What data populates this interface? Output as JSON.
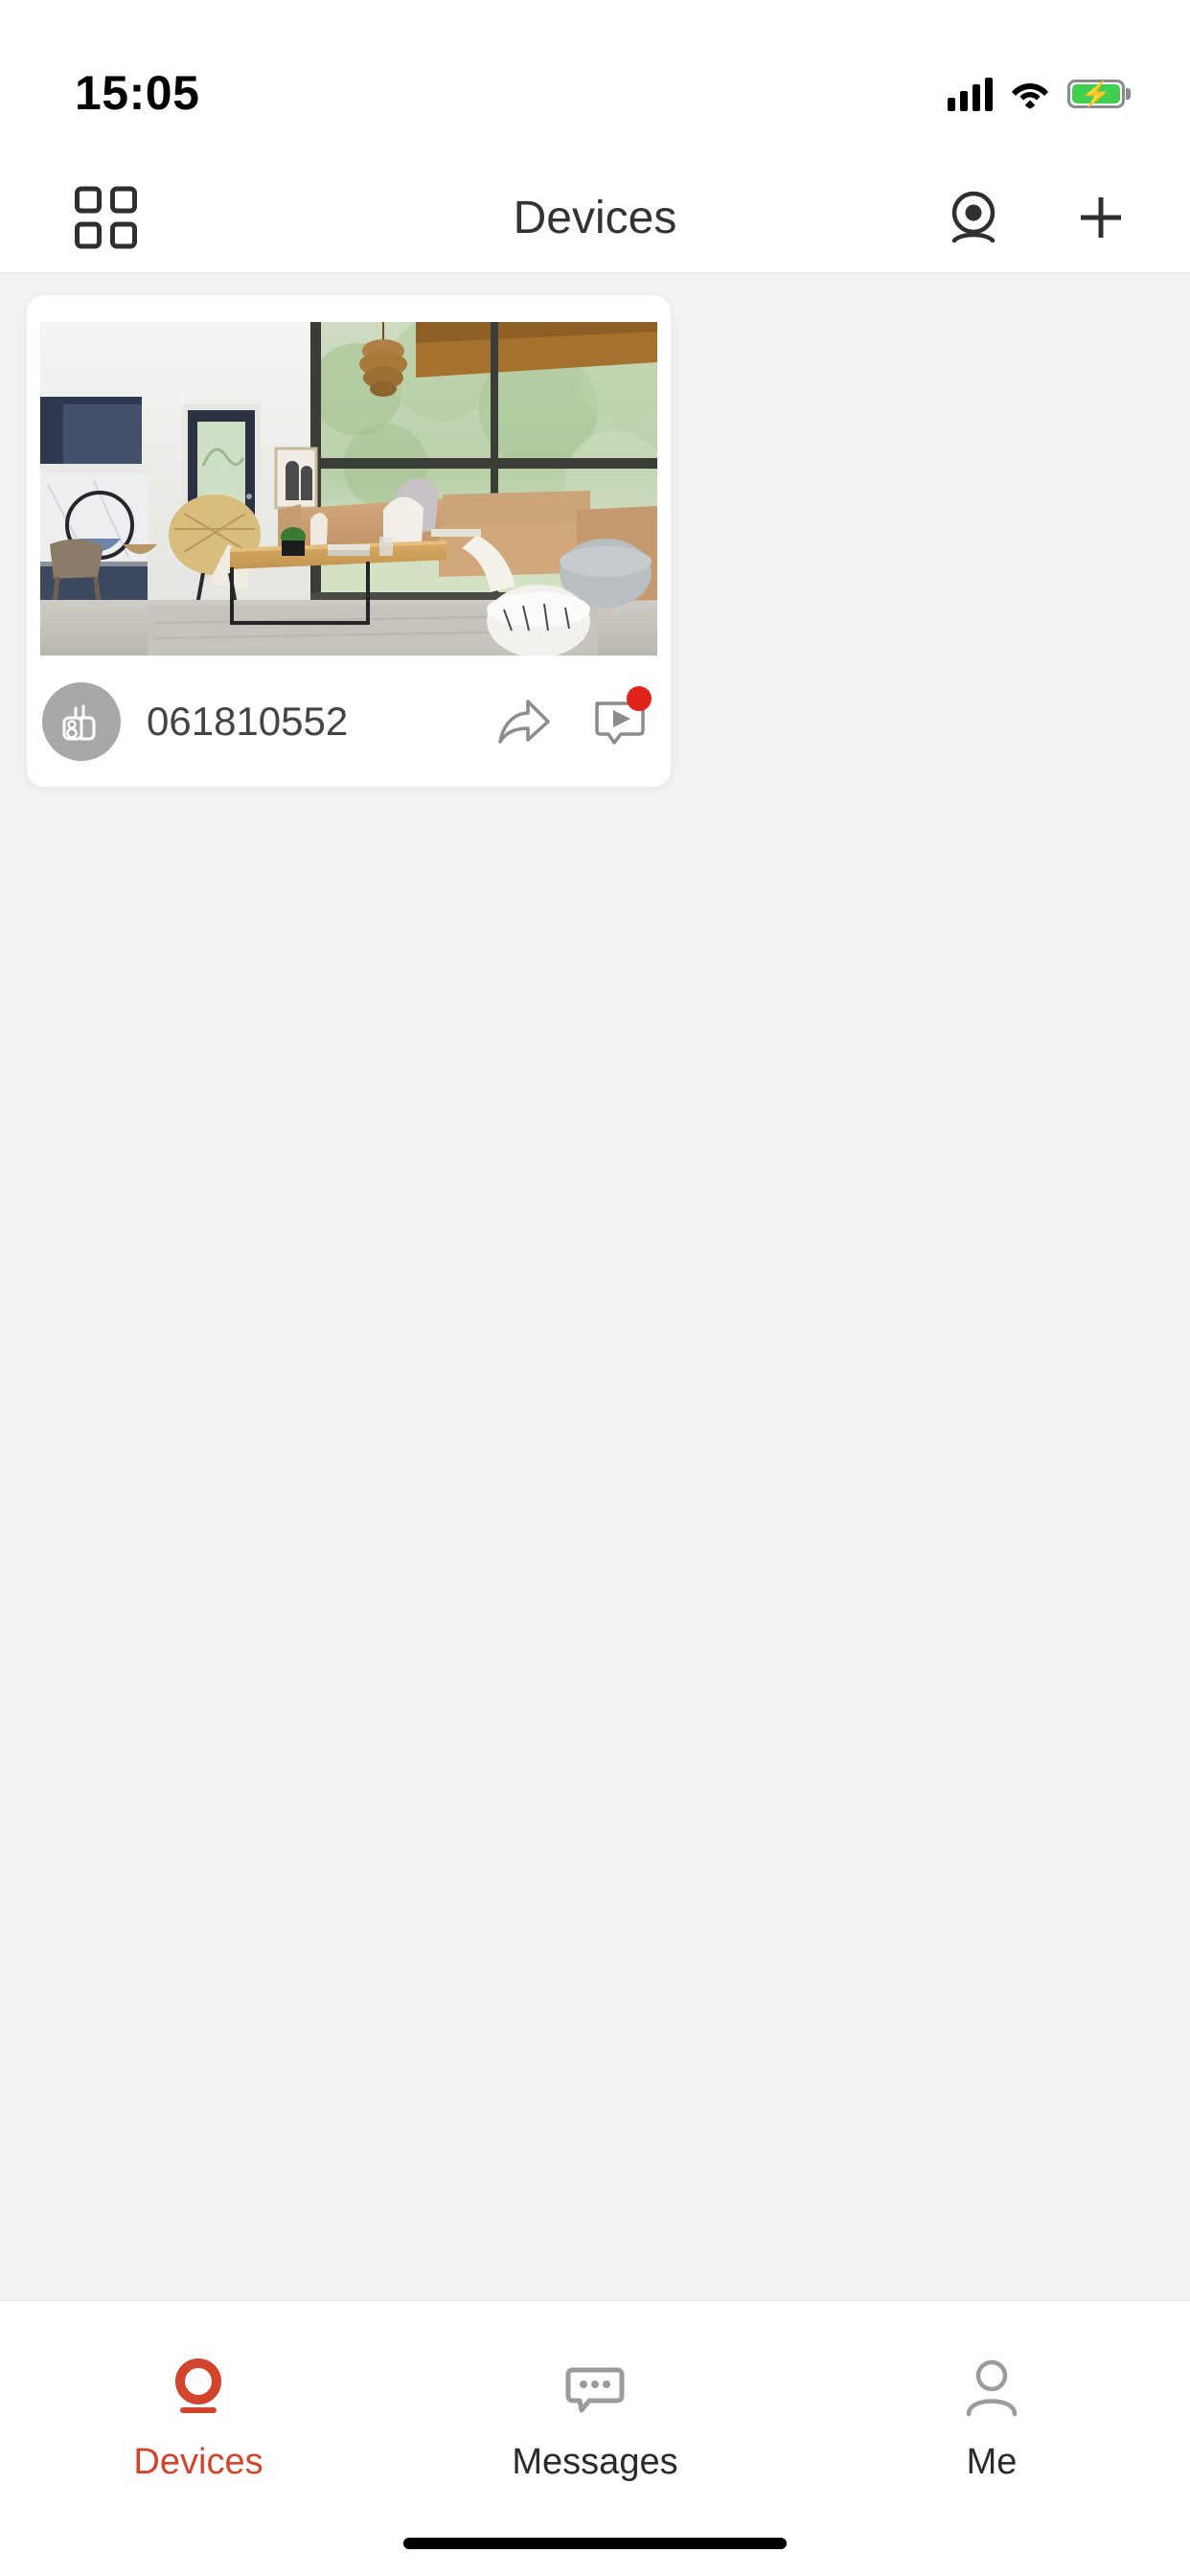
{
  "status_bar": {
    "time": "15:05",
    "signal_icon": "cellular-signal-icon",
    "wifi_icon": "wifi-icon",
    "battery_icon": "battery-charging-icon",
    "battery_color": "#3fd04f"
  },
  "header": {
    "title": "Devices",
    "grid_icon": "grid-view-icon",
    "camera_icon": "camera-icon",
    "add_icon": "plus-icon"
  },
  "devices": [
    {
      "name": "061810552",
      "device_icon": "security-camera-icon",
      "share_icon": "share-arrow-icon",
      "playback_icon": "message-play-icon",
      "has_notification": true,
      "notification_color": "#e0231a",
      "thumbnail_alt": "living-room-snapshot"
    }
  ],
  "tabs": [
    {
      "label": "Devices",
      "icon": "devices-camera-icon",
      "active": true
    },
    {
      "label": "Messages",
      "icon": "chat-bubble-icon",
      "active": false
    },
    {
      "label": "Me",
      "icon": "person-icon",
      "active": false
    }
  ],
  "theme": {
    "accent": "#d2452c",
    "background": "#f2f2f2",
    "card_background": "#ffffff",
    "text_primary": "#333333",
    "text_secondary": "#444444"
  }
}
